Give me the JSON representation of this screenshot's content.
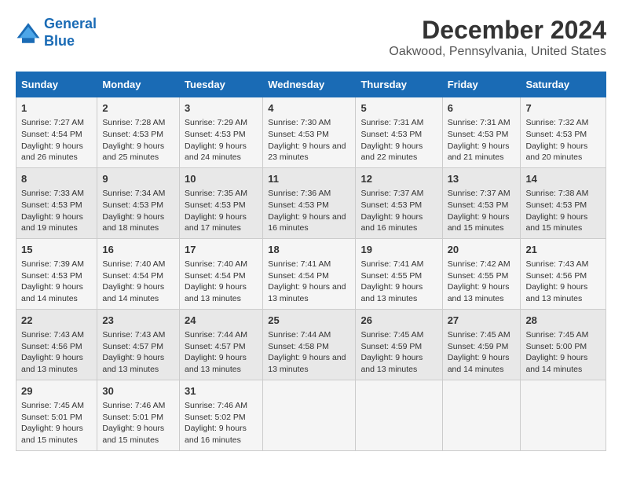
{
  "logo": {
    "line1": "General",
    "line2": "Blue"
  },
  "title": "December 2024",
  "subtitle": "Oakwood, Pennsylvania, United States",
  "headers": [
    "Sunday",
    "Monday",
    "Tuesday",
    "Wednesday",
    "Thursday",
    "Friday",
    "Saturday"
  ],
  "weeks": [
    [
      {
        "day": "1",
        "sunrise": "7:27 AM",
        "sunset": "4:54 PM",
        "daylight": "9 hours and 26 minutes."
      },
      {
        "day": "2",
        "sunrise": "7:28 AM",
        "sunset": "4:53 PM",
        "daylight": "9 hours and 25 minutes."
      },
      {
        "day": "3",
        "sunrise": "7:29 AM",
        "sunset": "4:53 PM",
        "daylight": "9 hours and 24 minutes."
      },
      {
        "day": "4",
        "sunrise": "7:30 AM",
        "sunset": "4:53 PM",
        "daylight": "9 hours and 23 minutes."
      },
      {
        "day": "5",
        "sunrise": "7:31 AM",
        "sunset": "4:53 PM",
        "daylight": "9 hours and 22 minutes."
      },
      {
        "day": "6",
        "sunrise": "7:31 AM",
        "sunset": "4:53 PM",
        "daylight": "9 hours and 21 minutes."
      },
      {
        "day": "7",
        "sunrise": "7:32 AM",
        "sunset": "4:53 PM",
        "daylight": "9 hours and 20 minutes."
      }
    ],
    [
      {
        "day": "8",
        "sunrise": "7:33 AM",
        "sunset": "4:53 PM",
        "daylight": "9 hours and 19 minutes."
      },
      {
        "day": "9",
        "sunrise": "7:34 AM",
        "sunset": "4:53 PM",
        "daylight": "9 hours and 18 minutes."
      },
      {
        "day": "10",
        "sunrise": "7:35 AM",
        "sunset": "4:53 PM",
        "daylight": "9 hours and 17 minutes."
      },
      {
        "day": "11",
        "sunrise": "7:36 AM",
        "sunset": "4:53 PM",
        "daylight": "9 hours and 16 minutes."
      },
      {
        "day": "12",
        "sunrise": "7:37 AM",
        "sunset": "4:53 PM",
        "daylight": "9 hours and 16 minutes."
      },
      {
        "day": "13",
        "sunrise": "7:37 AM",
        "sunset": "4:53 PM",
        "daylight": "9 hours and 15 minutes."
      },
      {
        "day": "14",
        "sunrise": "7:38 AM",
        "sunset": "4:53 PM",
        "daylight": "9 hours and 15 minutes."
      }
    ],
    [
      {
        "day": "15",
        "sunrise": "7:39 AM",
        "sunset": "4:53 PM",
        "daylight": "9 hours and 14 minutes."
      },
      {
        "day": "16",
        "sunrise": "7:40 AM",
        "sunset": "4:54 PM",
        "daylight": "9 hours and 14 minutes."
      },
      {
        "day": "17",
        "sunrise": "7:40 AM",
        "sunset": "4:54 PM",
        "daylight": "9 hours and 13 minutes."
      },
      {
        "day": "18",
        "sunrise": "7:41 AM",
        "sunset": "4:54 PM",
        "daylight": "9 hours and 13 minutes."
      },
      {
        "day": "19",
        "sunrise": "7:41 AM",
        "sunset": "4:55 PM",
        "daylight": "9 hours and 13 minutes."
      },
      {
        "day": "20",
        "sunrise": "7:42 AM",
        "sunset": "4:55 PM",
        "daylight": "9 hours and 13 minutes."
      },
      {
        "day": "21",
        "sunrise": "7:43 AM",
        "sunset": "4:56 PM",
        "daylight": "9 hours and 13 minutes."
      }
    ],
    [
      {
        "day": "22",
        "sunrise": "7:43 AM",
        "sunset": "4:56 PM",
        "daylight": "9 hours and 13 minutes."
      },
      {
        "day": "23",
        "sunrise": "7:43 AM",
        "sunset": "4:57 PM",
        "daylight": "9 hours and 13 minutes."
      },
      {
        "day": "24",
        "sunrise": "7:44 AM",
        "sunset": "4:57 PM",
        "daylight": "9 hours and 13 minutes."
      },
      {
        "day": "25",
        "sunrise": "7:44 AM",
        "sunset": "4:58 PM",
        "daylight": "9 hours and 13 minutes."
      },
      {
        "day": "26",
        "sunrise": "7:45 AM",
        "sunset": "4:59 PM",
        "daylight": "9 hours and 13 minutes."
      },
      {
        "day": "27",
        "sunrise": "7:45 AM",
        "sunset": "4:59 PM",
        "daylight": "9 hours and 14 minutes."
      },
      {
        "day": "28",
        "sunrise": "7:45 AM",
        "sunset": "5:00 PM",
        "daylight": "9 hours and 14 minutes."
      }
    ],
    [
      {
        "day": "29",
        "sunrise": "7:45 AM",
        "sunset": "5:01 PM",
        "daylight": "9 hours and 15 minutes."
      },
      {
        "day": "30",
        "sunrise": "7:46 AM",
        "sunset": "5:01 PM",
        "daylight": "9 hours and 15 minutes."
      },
      {
        "day": "31",
        "sunrise": "7:46 AM",
        "sunset": "5:02 PM",
        "daylight": "9 hours and 16 minutes."
      },
      null,
      null,
      null,
      null
    ]
  ],
  "labels": {
    "sunrise": "Sunrise:",
    "sunset": "Sunset:",
    "daylight": "Daylight:"
  },
  "accentColor": "#1a6bb5"
}
